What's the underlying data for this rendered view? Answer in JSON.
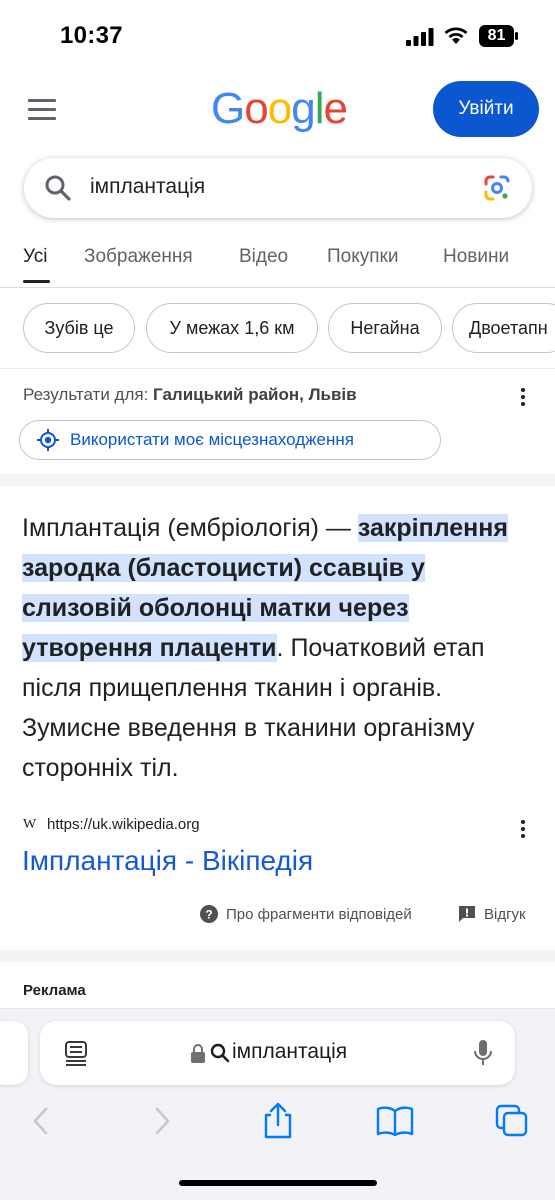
{
  "status_bar": {
    "time": "10:37",
    "battery": "81"
  },
  "header": {
    "menu_icon": "hamburger-icon",
    "logo_letters": [
      "G",
      "o",
      "o",
      "g",
      "l",
      "e"
    ],
    "signin_label": "Увійти"
  },
  "search": {
    "query": "імплантація",
    "search_icon": "search-icon",
    "lens_icon": "google-lens-icon"
  },
  "tabs": [
    {
      "label": "Усі",
      "active": true
    },
    {
      "label": "Зображення"
    },
    {
      "label": "Відео"
    },
    {
      "label": "Покупки"
    },
    {
      "label": "Новини"
    }
  ],
  "chips": [
    "Зубів це",
    "У межах 1,6 км",
    "Негайна",
    "Двоетапн"
  ],
  "location": {
    "prefix": "Результати для:",
    "place": "Галицький район, Львів",
    "use_location_label": "Використати моє місцезнаходження"
  },
  "snippet": {
    "lead": "Імплантація (ембріологія) —",
    "highlight": "закріплення зародка (бластоцисти) ссавців у слизовій оболонці матки через утворення плаценти",
    "rest": ". Початковий етап після прищеплення тканин і органів. Зумисне введення в тканини організму сторонніх тіл."
  },
  "source": {
    "favicon": "W",
    "url": "https://uk.wikipedia.org",
    "title": "Імплантація - Вікіпедія"
  },
  "footer": {
    "about_label": "Про фрагменти відповідей",
    "feedback_label": "Відгук"
  },
  "ad_label": "Реклама",
  "browser": {
    "url_text": "імплантація"
  },
  "colors": {
    "blue_button": "#0b57d0",
    "link": "#1558d6",
    "highlight": "#d3e3fd",
    "ios_blue": "#007aff"
  }
}
